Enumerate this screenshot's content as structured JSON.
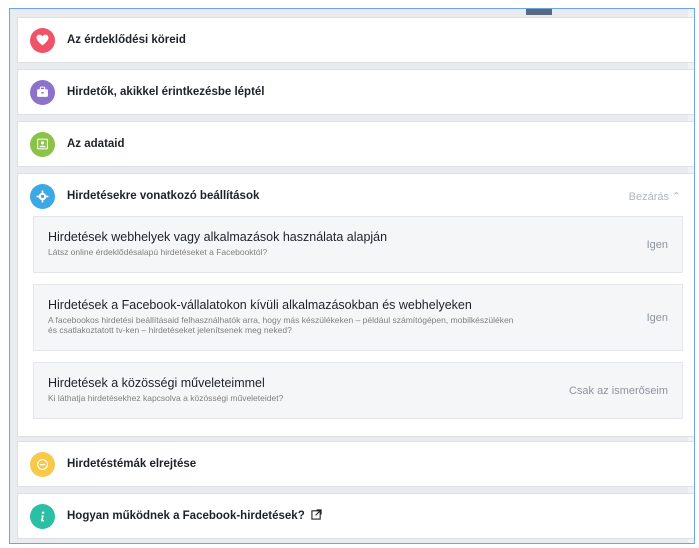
{
  "sections": {
    "interests": {
      "title": "Az érdeklődési köreid",
      "color": "#f05268",
      "icon": "heart-icon"
    },
    "advertisers": {
      "title": "Hirdetők, akikkel érintkezésbe léptél",
      "color": "#8c72cb",
      "icon": "briefcase-icon"
    },
    "your_info": {
      "title": "Az adataid",
      "color": "#8bc34a",
      "icon": "id-card-icon"
    },
    "ad_settings": {
      "title": "Hirdetésekre vonatkozó beállítások",
      "color": "#3ea8e5",
      "icon": "gear-icon",
      "close_label": "Bezárás",
      "items": [
        {
          "title": "Hirdetések webhelyek vagy alkalmazások használata alapján",
          "description": "Látsz online érdeklődésalapú hirdetéseket a Facebooktól?",
          "value": "Igen"
        },
        {
          "title": "Hirdetések a Facebook-vállalatokon kívüli alkalmazásokban és webhelyeken",
          "description": "A facebookos hirdetési beállításaid felhasználhatók arra, hogy más készülékeken – például számítógépen, mobilkészüléken és csatlakoztatott tv-ken – hirdetéseket jelenítsenek meg neked?",
          "value": "Igen"
        },
        {
          "title": "Hirdetések a közösségi műveleteimmel",
          "description": "Ki láthatja hirdetésekhez kapcsolva a közösségi műveleteidet?",
          "value": "Csak az ismerőseim"
        }
      ]
    },
    "hide_topics": {
      "title": "Hirdetéstémák elrejtése",
      "color": "#f7c948",
      "icon": "minus-circle-icon"
    },
    "how_it_works": {
      "title": "Hogyan működnek a Facebook-hirdetések?",
      "color": "#2bbfa4",
      "icon": "info-icon"
    }
  }
}
